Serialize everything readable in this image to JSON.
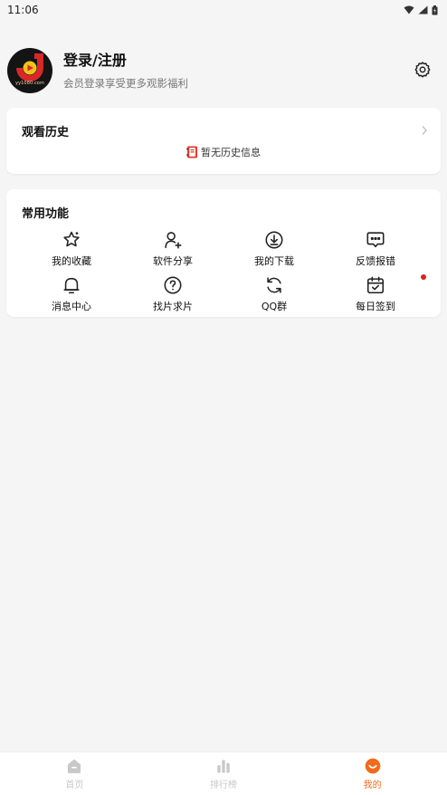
{
  "status_bar": {
    "time": "11:06"
  },
  "profile": {
    "avatar_caption": "yy1080.com",
    "login_title": "登录/注册",
    "login_subtitle": "会员登录享受更多观影福利"
  },
  "history": {
    "title": "观看历史",
    "empty_text": "暂无历史信息"
  },
  "functions": {
    "title": "常用功能",
    "items": [
      {
        "label": "我的收藏",
        "icon": "star-icon"
      },
      {
        "label": "软件分享",
        "icon": "user-add-icon"
      },
      {
        "label": "我的下载",
        "icon": "download-icon"
      },
      {
        "label": "反馈报错",
        "icon": "message-icon"
      },
      {
        "label": "消息中心",
        "icon": "bell-icon"
      },
      {
        "label": "找片求片",
        "icon": "help-icon"
      },
      {
        "label": "QQ群",
        "icon": "refresh-icon"
      },
      {
        "label": "每日签到",
        "icon": "calendar-check-icon"
      }
    ]
  },
  "bottom_nav": {
    "items": [
      {
        "label": "首页",
        "icon": "home-icon"
      },
      {
        "label": "排行榜",
        "icon": "bar-chart-icon"
      },
      {
        "label": "我的",
        "icon": "smile-icon"
      }
    ],
    "active_index": 2
  },
  "colors": {
    "accent": "#f26a1b",
    "background": "#f5f5f5",
    "badge": "#e02020"
  }
}
